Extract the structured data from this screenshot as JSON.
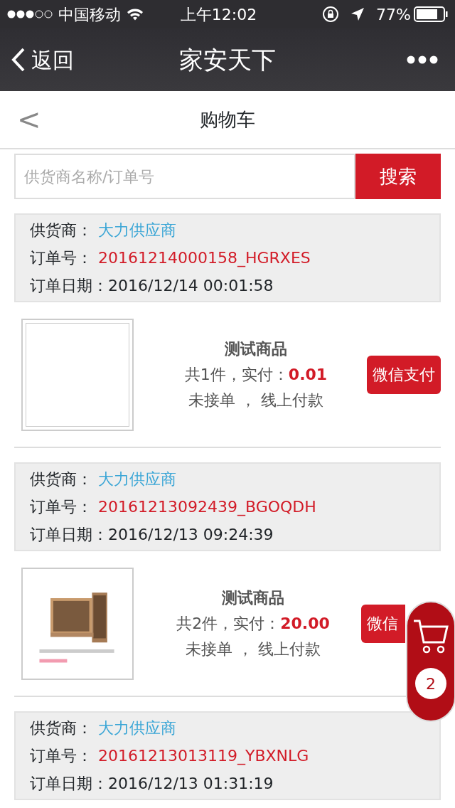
{
  "status_bar": {
    "carrier": "中国移动",
    "time": "上午12:02",
    "battery": "77%"
  },
  "nav_bar": {
    "back": "返回",
    "title": "家安天下"
  },
  "header": {
    "back": "<",
    "title": "购物车"
  },
  "search": {
    "placeholder": "供货商名称/订单号",
    "button": "搜索"
  },
  "orders": [
    {
      "supplier_label": "供货商：",
      "supplier": "大力供应商",
      "order_no_label": "订单号：",
      "order_no": "20161214000158_HGRXES",
      "date_label": "订单日期：",
      "date": "2016/12/14 00:01:58",
      "product": {
        "kind": "frame",
        "name": "测试商品",
        "qty": "共1件，实付：",
        "amount": "0.01",
        "status": "未接单 ，  线上付款",
        "pay_button": "微信支付"
      }
    },
    {
      "supplier_label": "供货商：",
      "supplier": "大力供应商",
      "order_no_label": "订单号：",
      "order_no": "20161213092439_BGOQDH",
      "date_label": "订单日期：",
      "date": "2016/12/13 09:24:39",
      "product": {
        "kind": "picture",
        "name": "测试商品",
        "qty": "共2件，实付：",
        "amount": "20.00",
        "status": "未接单 ，  线上付款",
        "pay_button": "微信"
      }
    },
    {
      "supplier_label": "供货商：",
      "supplier": "大力供应商",
      "order_no_label": "订单号：",
      "order_no": "20161213013119_YBXNLG",
      "date_label": "订单日期：",
      "date": "2016/12/13 01:31:19"
    }
  ],
  "cart": {
    "count": "2"
  }
}
